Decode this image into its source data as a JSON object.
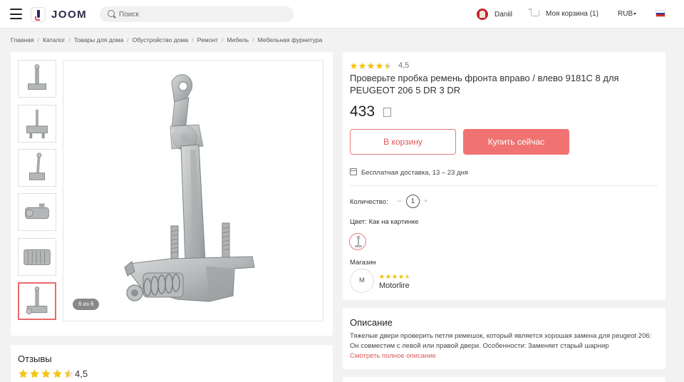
{
  "header": {
    "logo_text": "JOOM",
    "search_placeholder": "Поиск",
    "user_name": "Daniil",
    "cart_label": "Моя корзина (1)",
    "currency": "RUB",
    "flag_colors": [
      "#ffffff",
      "#1c3fa8",
      "#d52b1e"
    ]
  },
  "breadcrumb": [
    "Главная",
    "Каталог",
    "Товары для дома",
    "Обустройство дома",
    "Ремонт",
    "Мебель",
    "Мебельная фурнитура"
  ],
  "gallery": {
    "thumbnail_count": 6,
    "active_index": 6,
    "counter": "6 из 6"
  },
  "product": {
    "rating": "4,5",
    "rating_value": 4.5,
    "title": "Проверьте пробка ремень фронта вправо / влево 9181С 8 для PEUGEOT 206 5 DR 3 DR",
    "price": "433",
    "add_to_cart": "В корзину",
    "buy_now": "Купить сейчас",
    "delivery": "Бесплатная доставка, 13 – 23 дня",
    "quantity_label": "Количество:",
    "quantity_minus": "–",
    "quantity_value": "1",
    "quantity_plus": "+",
    "color_label": "Цвет:",
    "color_value": "Как на картинке",
    "store_heading": "Магазин",
    "store_initial": "M",
    "store_name": "Motorlire",
    "store_rating_value": 4.5
  },
  "description": {
    "heading": "Описание",
    "text": "Тяжелые двери проверить петля ремешок, который является хорошая замена для peugeot 206: Он совместим с левой или правой двери.  Особенности: Заменяет старый шарнир",
    "link": "Смотреть полное описание"
  },
  "reviews": {
    "heading": "Отзывы",
    "rating": "4,5",
    "rating_value": 4.5
  },
  "colors": {
    "accent": "#f07272",
    "accent_text": "#e0575a",
    "star": "#f5c518"
  }
}
